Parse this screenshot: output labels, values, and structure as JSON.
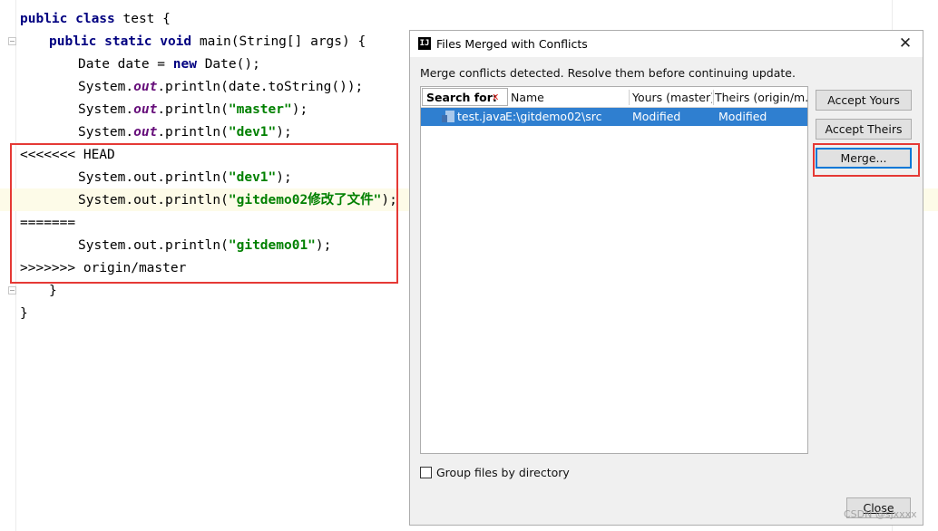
{
  "editor": {
    "line1": {
      "kw": "public class",
      "rest": " test {"
    },
    "line2": {
      "kw": "public static void",
      "rest": " main(String[] args) {"
    },
    "line3": {
      "type": "Date date = ",
      "kw": "new",
      "rest": " Date();"
    },
    "line4": {
      "pre": "System.",
      "field": "out",
      "rest": ".println(date.toString());"
    },
    "line5": {
      "pre": "System.",
      "field": "out",
      "mid": ".println(",
      "str": "\"master\"",
      "end": ");"
    },
    "line6": {
      "pre": "System.",
      "field": "out",
      "mid": ".println(",
      "str": "\"dev1\"",
      "end": ");"
    },
    "line7": {
      "text": "<<<<<<< HEAD"
    },
    "line8": {
      "pre": "System.out.println(",
      "str": "\"dev1\"",
      "end": ");"
    },
    "line9": {
      "pre": "System.out.println(",
      "str": "\"gitdemo02修改了文件\"",
      "end": ");"
    },
    "line10": {
      "text": "======="
    },
    "line11": {
      "pre": "System.out.println(",
      "str": "\"gitdemo01\"",
      "end": ");"
    },
    "line12": {
      "text": ">>>>>>> origin/master"
    },
    "line13": {
      "text": "}"
    },
    "line14": {
      "text": "}"
    }
  },
  "dialog": {
    "title": "Files Merged with Conflicts",
    "icon_text": "IJ",
    "close_icon": "✕",
    "message": "Merge conflicts detected. Resolve them before continuing update.",
    "search_label": "Search for:",
    "search_clear": "x",
    "columns": [
      "Name",
      "Yours (master)",
      "Theirs (origin/m..."
    ],
    "rows": [
      {
        "file": "test.java",
        "path": "E:\\gitdemo02\\src",
        "yours": "Modified",
        "theirs": "Modified"
      }
    ],
    "buttons": {
      "accept_yours": "Accept Yours",
      "accept_theirs": "Accept Theirs",
      "merge": "Merge...",
      "close": "Close"
    },
    "group_checkbox_label": "Group files by directory"
  },
  "watermark": "CSDN @sjxxxx",
  "colors": {
    "keyword": "#000080",
    "string": "#008000",
    "field": "#660e7a",
    "selection": "#2f7fd0",
    "highlight_box": "#e53935"
  }
}
